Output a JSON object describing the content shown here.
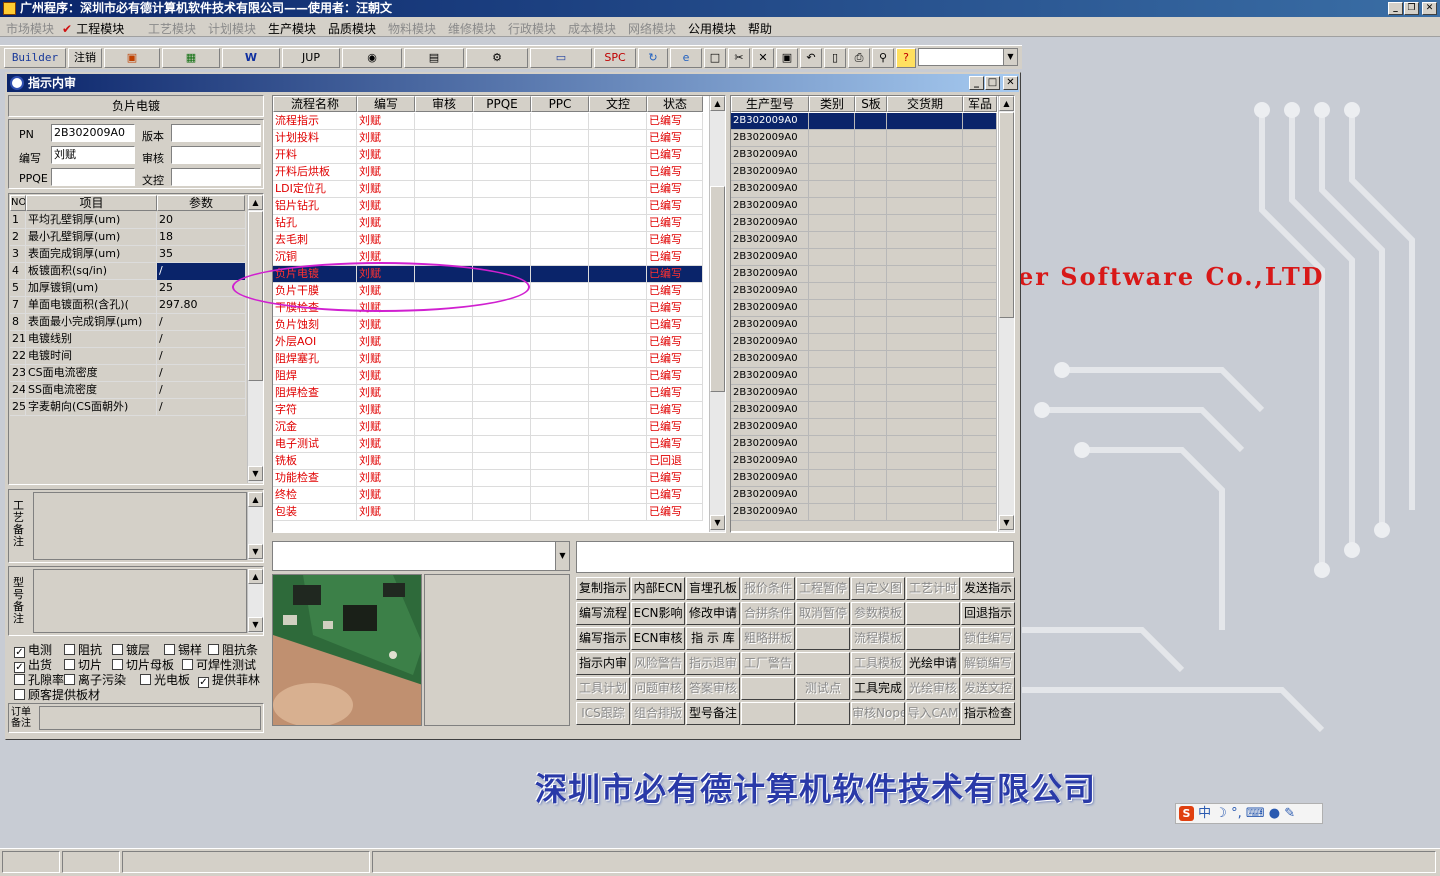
{
  "app": {
    "title": "广州程序：深圳市必有德计算机软件技术有限公司——使用者：汪朝文"
  },
  "menu": [
    {
      "label": "市场模块",
      "enabled": false
    },
    {
      "label": "工程模块",
      "enabled": true,
      "checked": true
    },
    {
      "label": "工艺模块",
      "enabled": false
    },
    {
      "label": "计划模块",
      "enabled": false
    },
    {
      "label": "生产模块",
      "enabled": true
    },
    {
      "label": "品质模块",
      "enabled": true
    },
    {
      "label": "物料模块",
      "enabled": false
    },
    {
      "label": "维修模块",
      "enabled": false
    },
    {
      "label": "行政模块",
      "enabled": false
    },
    {
      "label": "成本模块",
      "enabled": false
    },
    {
      "label": "网络模块",
      "enabled": false
    },
    {
      "label": "公用模块",
      "enabled": true
    },
    {
      "label": "帮助",
      "enabled": true
    }
  ],
  "toolbar": {
    "builder": "Builder",
    "logout": "注销",
    "jup": "JUP",
    "spc": "SPC"
  },
  "window": {
    "title": "指示内审"
  },
  "left": {
    "section_title": "负片电镀",
    "pn_label": "PN",
    "pn_value": "2B302009A0",
    "version_label": "版本",
    "version_value": "",
    "author_label": "编写",
    "author_value": "刘赋",
    "review_label": "审核",
    "review_value": "",
    "ppqe_label": "PPQE",
    "ppqe_value": "",
    "doc_label": "文控",
    "doc_value": "",
    "param_headers": {
      "no": "NO",
      "item": "项目",
      "value": "参数"
    },
    "params": [
      {
        "no": "1",
        "item": "平均孔壁铜厚(um)",
        "value": "20"
      },
      {
        "no": "2",
        "item": "最小孔壁铜厚(um)",
        "value": "18"
      },
      {
        "no": "3",
        "item": "表面完成铜厚(um)",
        "value": "35"
      },
      {
        "no": "4",
        "item": "板镀面积(sq/in)",
        "value": "/"
      },
      {
        "no": "5",
        "item": "加厚镀铜(um)",
        "value": "25"
      },
      {
        "no": "7",
        "item": "单面电镀面积(含孔)(",
        "value": "297.80"
      },
      {
        "no": "8",
        "item": "表面最小完成铜厚(μm)",
        "value": "/"
      },
      {
        "no": "21",
        "item": "电镀线别",
        "value": "/"
      },
      {
        "no": "22",
        "item": "电镀时间",
        "value": "/"
      },
      {
        "no": "23",
        "item": "CS面电流密度",
        "value": "/"
      },
      {
        "no": "24",
        "item": "SS面电流密度",
        "value": "/"
      },
      {
        "no": "25",
        "item": "字麦朝向(CS面朝外)",
        "value": "/"
      }
    ],
    "craft_note_label": "工艺备注",
    "model_note_label": "型号备注",
    "checkboxes": [
      {
        "label": "电测",
        "checked": true
      },
      {
        "label": "阻抗",
        "checked": false
      },
      {
        "label": "镀层",
        "checked": false
      },
      {
        "label": "锡样",
        "checked": false
      },
      {
        "label": "阻抗条",
        "checked": false
      },
      {
        "label": "出货",
        "checked": true
      },
      {
        "label": "切片",
        "checked": false
      },
      {
        "label": "切片母板",
        "checked": false
      },
      {
        "label": "可焊性测试",
        "checked": false
      },
      {
        "label": "孔隙率",
        "checked": false
      },
      {
        "label": "离子污染",
        "checked": false
      },
      {
        "label": "光电板",
        "checked": false
      },
      {
        "label": "提供菲林",
        "checked": true
      },
      {
        "label": "顾客提供板材",
        "checked": false
      }
    ],
    "order_note_label": "订单备注"
  },
  "process_table": {
    "headers": [
      "流程名称",
      "编写",
      "审核",
      "PPQE",
      "PPC",
      "文控",
      "状态"
    ],
    "rows": [
      {
        "name": "流程指示",
        "author": "刘赋",
        "status": "已编写"
      },
      {
        "name": "计划投料",
        "author": "刘赋",
        "status": "已编写"
      },
      {
        "name": "开料",
        "author": "刘赋",
        "status": "已编写"
      },
      {
        "name": "开料后烘板",
        "author": "刘赋",
        "status": "已编写"
      },
      {
        "name": "LDI定位孔",
        "author": "刘赋",
        "status": "已编写"
      },
      {
        "name": "铝片钻孔",
        "author": "刘赋",
        "status": "已编写"
      },
      {
        "name": "钻孔",
        "author": "刘赋",
        "status": "已编写"
      },
      {
        "name": "去毛刺",
        "author": "刘赋",
        "status": "已编写"
      },
      {
        "name": "沉铜",
        "author": "刘赋",
        "status": "已编写"
      },
      {
        "name": "负片电镀",
        "author": "刘赋",
        "status": "已编写",
        "selected": true
      },
      {
        "name": "负片干膜",
        "author": "刘赋",
        "status": "已编写"
      },
      {
        "name": "干膜检查",
        "author": "刘赋",
        "status": "已编写"
      },
      {
        "name": "负片蚀刻",
        "author": "刘赋",
        "status": "已编写"
      },
      {
        "name": "外层AOI",
        "author": "刘赋",
        "status": "已编写"
      },
      {
        "name": "阻焊塞孔",
        "author": "刘赋",
        "status": "已编写"
      },
      {
        "name": "阻焊",
        "author": "刘赋",
        "status": "已编写"
      },
      {
        "name": "阻焊检查",
        "author": "刘赋",
        "status": "已编写"
      },
      {
        "name": "字符",
        "author": "刘赋",
        "status": "已编写"
      },
      {
        "name": "沉金",
        "author": "刘赋",
        "status": "已编写"
      },
      {
        "name": "电子测试",
        "author": "刘赋",
        "status": "已编写"
      },
      {
        "name": "铣板",
        "author": "刘赋",
        "status": "已回退"
      },
      {
        "name": "功能检查",
        "author": "刘赋",
        "status": "已编写"
      },
      {
        "name": "终检",
        "author": "刘赋",
        "status": "已编写"
      },
      {
        "name": "包装",
        "author": "刘赋",
        "status": "已编写"
      }
    ]
  },
  "model_table": {
    "headers": [
      "生产型号",
      "类别",
      "S板",
      "交货期",
      "军品"
    ],
    "rows": [
      "2B302009A0",
      "2B302009A0",
      "2B302009A0",
      "2B302009A0",
      "2B302009A0",
      "2B302009A0",
      "2B302009A0",
      "2B302009A0",
      "2B302009A0",
      "2B302009A0",
      "2B302009A0",
      "2B302009A0",
      "2B302009A0",
      "2B302009A0",
      "2B302009A0",
      "2B302009A0",
      "2B302009A0",
      "2B302009A0",
      "2B302009A0",
      "2B302009A0",
      "2B302009A0",
      "2B302009A0",
      "2B302009A0",
      "2B302009A0"
    ]
  },
  "actions": [
    [
      {
        "label": "复制指示",
        "enabled": true
      },
      {
        "label": "内部ECN",
        "enabled": true
      },
      {
        "label": "盲埋孔板",
        "enabled": true
      },
      {
        "label": "报价条件",
        "enabled": false
      },
      {
        "label": "工程暂停",
        "enabled": false
      },
      {
        "label": "自定义图",
        "enabled": false
      },
      {
        "label": "工艺计时",
        "enabled": false
      },
      {
        "label": "发送指示",
        "enabled": true
      }
    ],
    [
      {
        "label": "编写流程",
        "enabled": true
      },
      {
        "label": "ECN影响",
        "enabled": true
      },
      {
        "label": "修改申请",
        "enabled": true
      },
      {
        "label": "合拼条件",
        "enabled": false
      },
      {
        "label": "取消暂停",
        "enabled": false
      },
      {
        "label": "参数模板",
        "enabled": false
      },
      {
        "label": "",
        "enabled": false
      },
      {
        "label": "回退指示",
        "enabled": true
      }
    ],
    [
      {
        "label": "编写指示",
        "enabled": true
      },
      {
        "label": "ECN审核",
        "enabled": true
      },
      {
        "label": "指 示 库",
        "enabled": true
      },
      {
        "label": "粗略拼板",
        "enabled": false
      },
      {
        "label": "",
        "enabled": false
      },
      {
        "label": "流程模板",
        "enabled": false
      },
      {
        "label": "",
        "enabled": false
      },
      {
        "label": "锁住编写",
        "enabled": false
      }
    ],
    [
      {
        "label": "指示内审",
        "enabled": true
      },
      {
        "label": "风险警告",
        "enabled": false
      },
      {
        "label": "指示退审",
        "enabled": false
      },
      {
        "label": "工厂警告",
        "enabled": false
      },
      {
        "label": "",
        "enabled": false
      },
      {
        "label": "工具模板",
        "enabled": false
      },
      {
        "label": "光绘申请",
        "enabled": true
      },
      {
        "label": "解锁编写",
        "enabled": false
      }
    ],
    [
      {
        "label": "工具计划",
        "enabled": false
      },
      {
        "label": "问题审核",
        "enabled": false
      },
      {
        "label": "答案审核",
        "enabled": false
      },
      {
        "label": "",
        "enabled": false
      },
      {
        "label": "测试点",
        "enabled": false
      },
      {
        "label": "工具完成",
        "enabled": true
      },
      {
        "label": "光绘审核",
        "enabled": false
      },
      {
        "label": "发送文控",
        "enabled": false
      }
    ],
    [
      {
        "label": "ICS跟踪",
        "enabled": false
      },
      {
        "label": "组合排版",
        "enabled": false
      },
      {
        "label": "型号备注",
        "enabled": true
      },
      {
        "label": "",
        "enabled": false
      },
      {
        "label": "",
        "enabled": false
      },
      {
        "label": "审核Nope",
        "enabled": false
      },
      {
        "label": "导入CAM",
        "enabled": false
      },
      {
        "label": "指示检查",
        "enabled": true
      }
    ]
  ],
  "background": {
    "tagline": "er Software Co.,LTD",
    "company": "深圳市必有德计算机软件技术有限公司"
  },
  "ime": {
    "s": "S",
    "mode": "中"
  },
  "colors": {
    "titlebar": "#0a246a",
    "selected_row": "#0a246a",
    "process_text": "#e00000",
    "annotation": "#d020d0"
  }
}
